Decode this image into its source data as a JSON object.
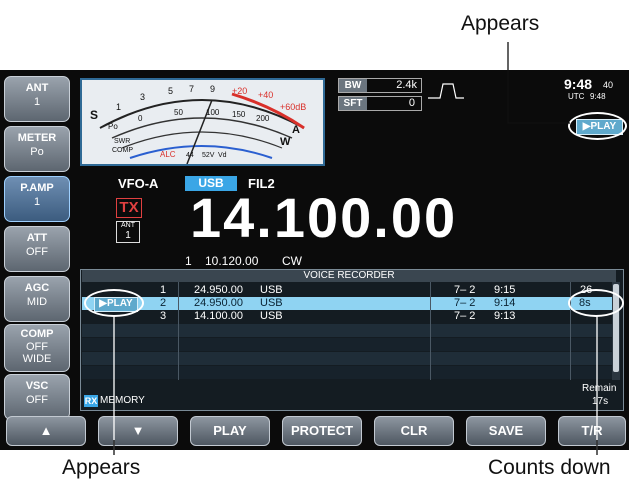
{
  "callouts": {
    "top_right": "Appears",
    "bottom_left": "Appears",
    "bottom_right": "Counts down"
  },
  "side_buttons": [
    {
      "label": "ANT",
      "value": "1"
    },
    {
      "label": "METER",
      "value": "Po"
    },
    {
      "label": "P.AMP",
      "value": "1"
    },
    {
      "label": "ATT",
      "value": "OFF"
    },
    {
      "label": "AGC",
      "value": "MID"
    },
    {
      "label": "COMP",
      "value": "OFF",
      "value2": "WIDE"
    },
    {
      "label": "VSC",
      "value": "OFF"
    }
  ],
  "meter": {
    "s_label": "S",
    "s_scale": [
      "1",
      "3",
      "5",
      "7",
      "9",
      "+20",
      "+40",
      "+60dB"
    ],
    "po_label": "Po",
    "po_scale": [
      "0",
      "50",
      "100",
      "150",
      "200"
    ],
    "a_label": "A",
    "w_label": "W",
    "swr_label": "SWR",
    "comp_label": "COMP",
    "alc_label": "ALC",
    "vd_label": "Vd",
    "vd_scale": [
      "44",
      "52V"
    ]
  },
  "bw": {
    "label": "BW",
    "value": "2.4k"
  },
  "sft": {
    "label": "SFT",
    "value": "0"
  },
  "clock": {
    "time": "9:48",
    "seconds": "40",
    "utc_label": "UTC",
    "utc_time": "9:48"
  },
  "play_badge": "▶PLAY",
  "vfo": {
    "label": "VFO-A",
    "mode": "USB",
    "filter": "FIL2"
  },
  "tx_label": "TX",
  "ant_indicator": {
    "label": "ANT",
    "value": "1"
  },
  "frequency": "14.100.00",
  "sub": {
    "vfo": "1",
    "frequency": "10.120.00",
    "mode": "CW"
  },
  "recorder": {
    "title": "VOICE RECORDER",
    "rows": [
      {
        "num": "1",
        "freq": "24.950.00",
        "mode": "USB",
        "date": "7‒ 2",
        "time": "9:15",
        "length": "26"
      },
      {
        "num": "2",
        "freq": "24.950.00",
        "mode": "USB",
        "date": "7‒ 2",
        "time": "9:14",
        "length": "8s"
      },
      {
        "num": "3",
        "freq": "14.100.00",
        "mode": "USB",
        "date": "7‒ 2",
        "time": "9:13",
        "length": ""
      }
    ],
    "rx_tag": "RX",
    "memory_label": "MEMORY",
    "remain_label": "Remain",
    "remain_value": "17s"
  },
  "function_keys": [
    "▲",
    "▼",
    "PLAY",
    "PROTECT",
    "CLR",
    "SAVE",
    "T/R"
  ]
}
